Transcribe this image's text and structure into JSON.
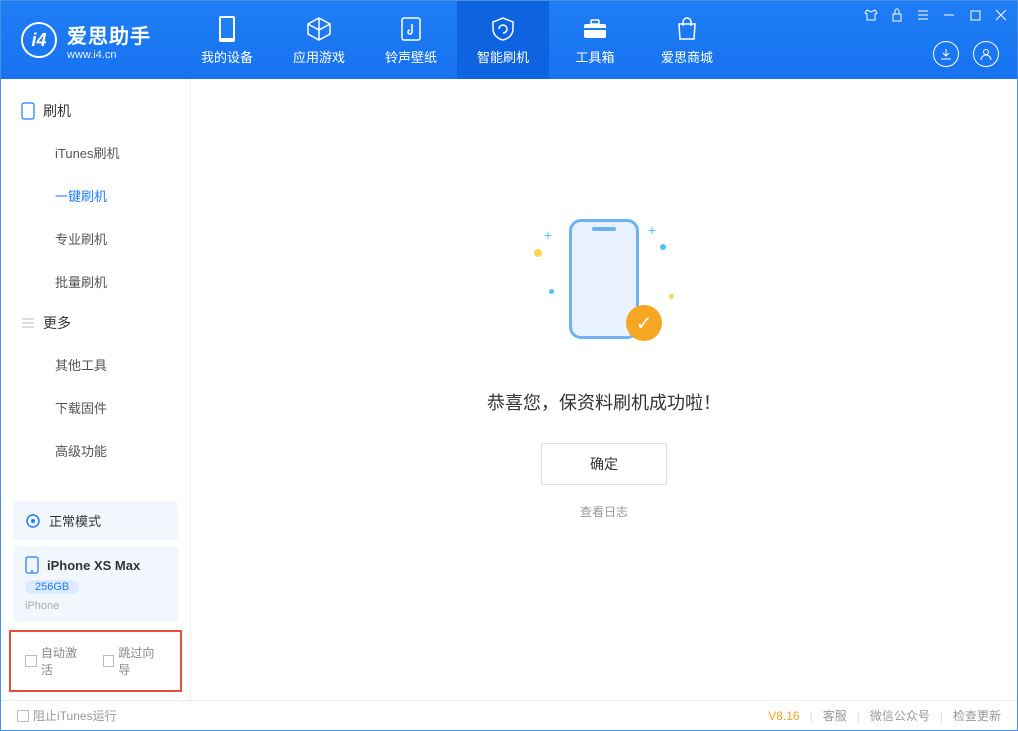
{
  "app": {
    "title": "爱思助手",
    "url": "www.i4.cn"
  },
  "nav": {
    "tabs": [
      {
        "label": "我的设备"
      },
      {
        "label": "应用游戏"
      },
      {
        "label": "铃声壁纸"
      },
      {
        "label": "智能刷机"
      },
      {
        "label": "工具箱"
      },
      {
        "label": "爱思商城"
      }
    ]
  },
  "sidebar": {
    "section1_title": "刷机",
    "section1": [
      {
        "label": "iTunes刷机"
      },
      {
        "label": "一键刷机"
      },
      {
        "label": "专业刷机"
      },
      {
        "label": "批量刷机"
      }
    ],
    "section2_title": "更多",
    "section2": [
      {
        "label": "其他工具"
      },
      {
        "label": "下载固件"
      },
      {
        "label": "高级功能"
      }
    ],
    "mode": "正常模式",
    "device": {
      "name": "iPhone XS Max",
      "storage": "256GB",
      "type": "iPhone"
    },
    "checkboxes": {
      "auto_activate": "自动激活",
      "skip_guide": "跳过向导"
    }
  },
  "main": {
    "success_text": "恭喜您，保资料刷机成功啦！",
    "confirm": "确定",
    "view_log": "查看日志"
  },
  "footer": {
    "block_itunes": "阻止iTunes运行",
    "version": "V8.16",
    "links": {
      "service": "客服",
      "wechat": "微信公众号",
      "update": "检查更新"
    }
  }
}
